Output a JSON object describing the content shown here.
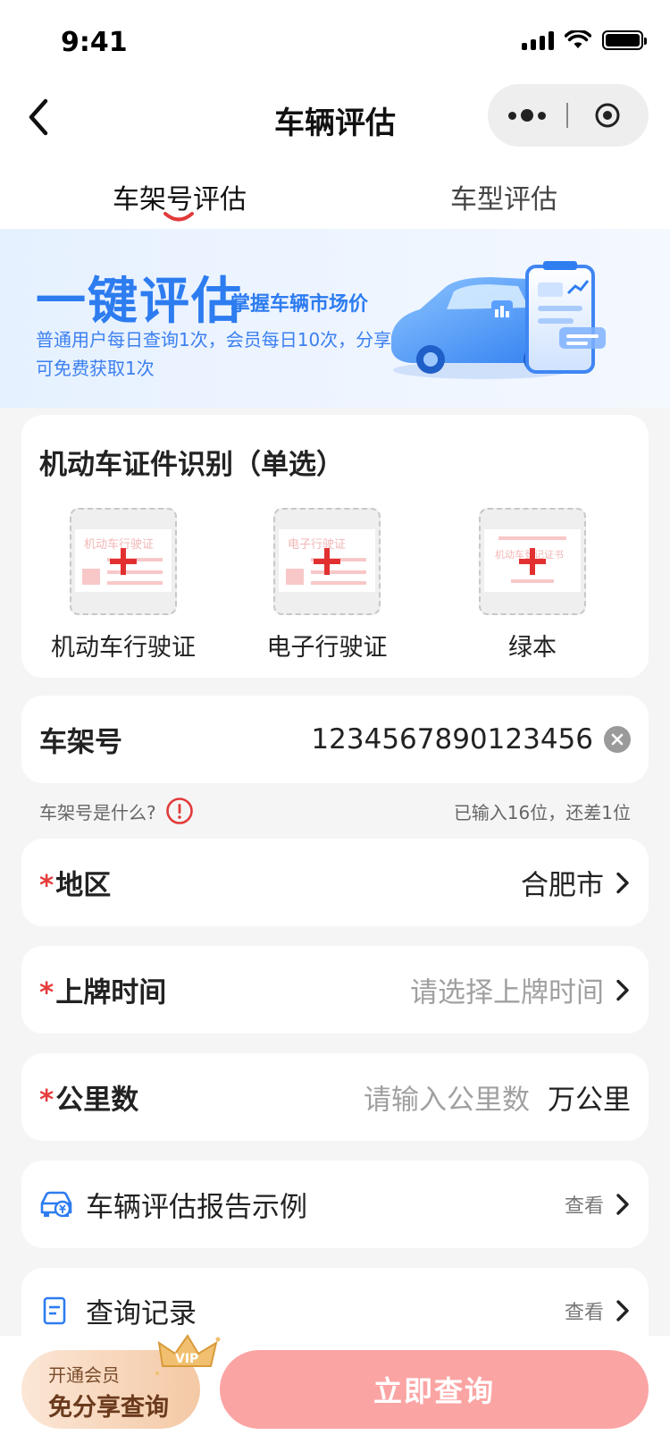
{
  "status_bar": {
    "time": "9:41",
    "battery_level": 1.0
  },
  "nav": {
    "title": "车辆评估",
    "capsule_more_icon": "more-dots-icon",
    "capsule_close_icon": "target-circle-icon"
  },
  "tabs": [
    {
      "label": "车架号评估",
      "active": true
    },
    {
      "label": "车型评估",
      "active": false
    }
  ],
  "banner": {
    "title": "一键评估",
    "subtitle": "掌握车辆市场价",
    "description": "普通用户每日查询1次，会员每日10次，分享可免费获取1次"
  },
  "certificate": {
    "title": "机动车证件识别（单选）",
    "options": [
      {
        "label": "机动车行驶证",
        "doc_text": "机动车行驶证"
      },
      {
        "label": "电子行驶证",
        "doc_text": "电子行驶证"
      },
      {
        "label": "绿本",
        "doc_text": "机动车登记证书"
      }
    ]
  },
  "vin": {
    "label": "车架号",
    "value": "1234567890123456",
    "help_text": "车架号是什么?",
    "count_text": "已输入16位，还差1位"
  },
  "region": {
    "required": "*",
    "label": "地区",
    "value": "合肥市"
  },
  "plate_time": {
    "required": "*",
    "label": "上牌时间",
    "placeholder": "请选择上牌时间"
  },
  "mileage": {
    "required": "*",
    "label": "公里数",
    "placeholder": "请输入公里数",
    "unit": "万公里"
  },
  "links": [
    {
      "label": "车辆评估报告示例",
      "action": "查看",
      "icon": "car-yuan-icon"
    },
    {
      "label": "查询记录",
      "action": "查看",
      "icon": "document-list-icon"
    }
  ],
  "bottom": {
    "vip_line1": "开通会员",
    "vip_line2": "免分享查询",
    "vip_badge": "VIP",
    "query_button": "立即查询"
  },
  "colors": {
    "primary_blue": "#2d7cf0",
    "danger_red": "#e63c3c",
    "query_button": "#fba4a4",
    "vip_gold": "#f4c9a5"
  }
}
